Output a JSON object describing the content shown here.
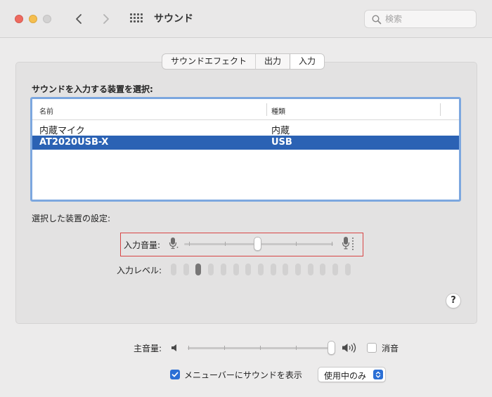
{
  "window": {
    "title": "サウンド",
    "search_placeholder": "検索"
  },
  "tabs": [
    {
      "label": "サウンドエフェクト",
      "active": false
    },
    {
      "label": "出力",
      "active": false
    },
    {
      "label": "入力",
      "active": true
    }
  ],
  "input_section": {
    "label": "サウンドを入力する装置を選択:",
    "columns": [
      "名前",
      "種類"
    ],
    "devices": [
      {
        "name": "内蔵マイク",
        "type": "内蔵",
        "selected": false
      },
      {
        "name": "AT2020USB-X",
        "type": "USB",
        "selected": true
      }
    ]
  },
  "settings": {
    "label": "選択した装置の設定:",
    "input_volume_label": "入力音量:",
    "input_volume": 0.5,
    "input_level_label": "入力レベル:",
    "input_level_segments": 15,
    "input_level_active": 1
  },
  "help_label": "?",
  "output": {
    "main_volume_label": "主音量:",
    "main_volume": 1.0,
    "mute_label": "消音",
    "mute_checked": false,
    "show_in_menubar_label": "メニューバーにサウンドを表示",
    "show_in_menubar_checked": true,
    "show_mode": "使用中のみ"
  },
  "colors": {
    "accent": "#2b6fd5",
    "selection": "#2b62b4",
    "highlight_border": "#d84545"
  }
}
